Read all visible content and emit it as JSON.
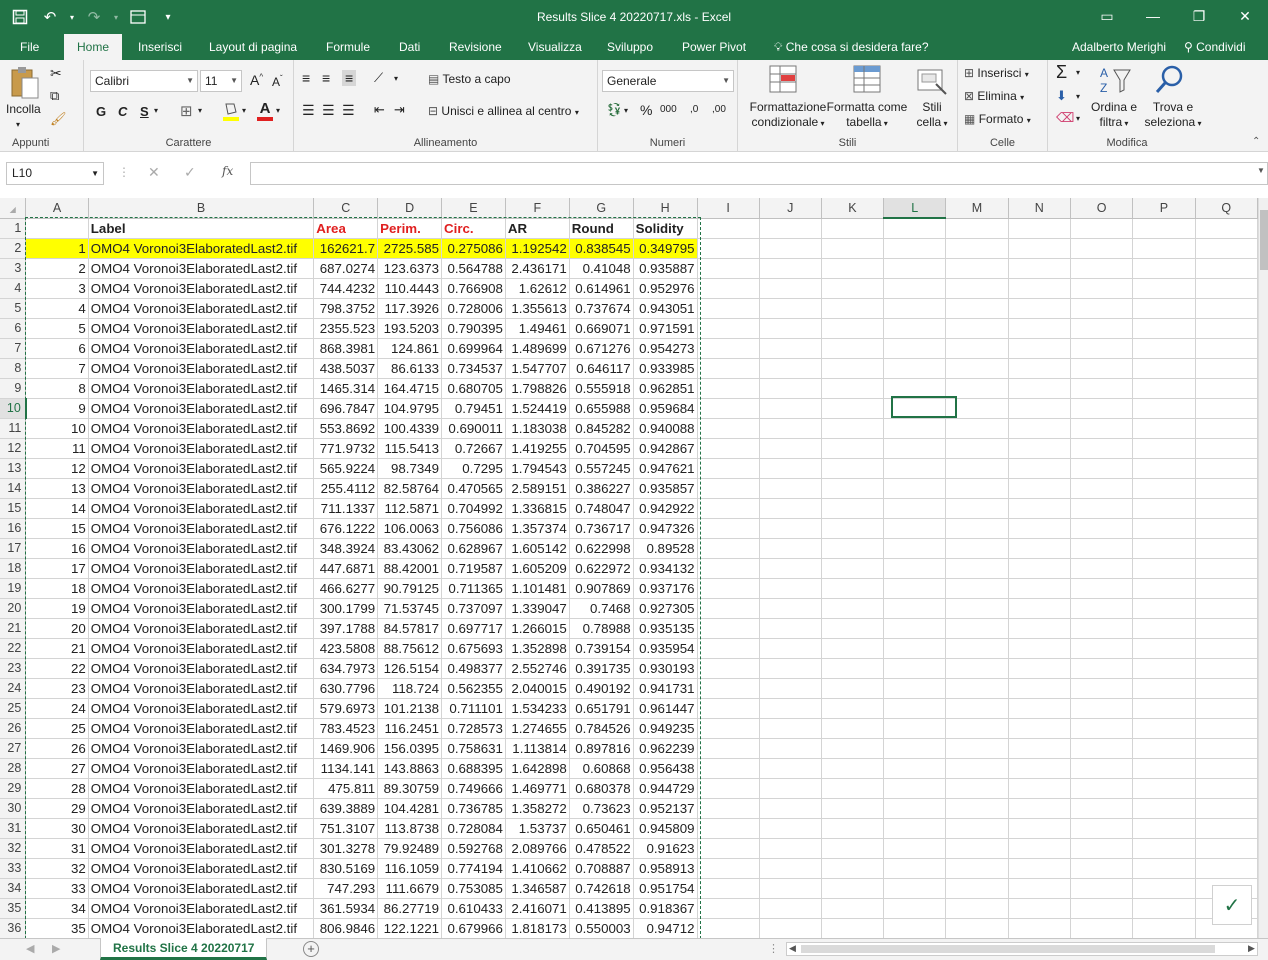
{
  "window": {
    "title": "Results Slice 4 20220717.xls - Excel",
    "qat": {
      "save_icon": "save-icon",
      "undo_icon": "undo-icon",
      "redo_icon": "redo-icon"
    }
  },
  "tabs": [
    "File",
    "Home",
    "Inserisci",
    "Layout di pagina",
    "Formule",
    "Dati",
    "Revisione",
    "Visualizza",
    "Sviluppo",
    "Power Pivot"
  ],
  "active_tab": "Home",
  "tell_me": "Che cosa si desidera fare?",
  "user": "Adalberto Merighi",
  "share": "Condividi",
  "ribbon": {
    "clipboard": {
      "paste": "Incolla",
      "label": "Appunti"
    },
    "font": {
      "name": "Calibri",
      "size": "11",
      "bold": "G",
      "italic": "C",
      "underline": "S",
      "label": "Carattere",
      "grow": "A",
      "shrink": "A",
      "color_letter": "A"
    },
    "alignment": {
      "wrap": "Testo a capo",
      "merge": "Unisci e allinea al centro",
      "label": "Allineamento"
    },
    "number": {
      "format": "Generale",
      "percent": "%",
      "thousands": "000",
      "dec_inc": ",0",
      "dec_dec": ",00",
      "label": "Numeri"
    },
    "styles": {
      "cond": "Formattazione",
      "cond2": "condizionale",
      "table": "Formatta come",
      "table2": "tabella",
      "cell": "Stili",
      "cell2": "cella",
      "label": "Stili"
    },
    "cells": {
      "insert": "Inserisci",
      "delete": "Elimina",
      "format": "Formato",
      "label": "Celle"
    },
    "editing": {
      "sort": "Ordina e",
      "sort2": "filtra",
      "find": "Trova e",
      "find2": "seleziona",
      "label": "Modifica"
    }
  },
  "formula_bar": {
    "name_box": "L10",
    "fx": "fx",
    "value": ""
  },
  "columns": [
    "A",
    "B",
    "C",
    "D",
    "E",
    "F",
    "G",
    "H",
    "I",
    "J",
    "K",
    "L",
    "M",
    "N",
    "O",
    "P",
    "Q"
  ],
  "headers": [
    "",
    "Label",
    "Area",
    "Perim.",
    "Circ.",
    "AR",
    "Round",
    "Solidity"
  ],
  "label_text": "OMO4 Voronoi3ElaboratedLast2.tif",
  "rows": [
    [
      "1",
      "162621.7",
      "2725.585",
      "0.275086",
      "1.192542",
      "0.838545",
      "0.349795"
    ],
    [
      "2",
      "687.0274",
      "123.6373",
      "0.564788",
      "2.436171",
      "0.41048",
      "0.935887"
    ],
    [
      "3",
      "744.4232",
      "110.4443",
      "0.766908",
      "1.62612",
      "0.614961",
      "0.952976"
    ],
    [
      "4",
      "798.3752",
      "117.3926",
      "0.728006",
      "1.355613",
      "0.737674",
      "0.943051"
    ],
    [
      "5",
      "2355.523",
      "193.5203",
      "0.790395",
      "1.49461",
      "0.669071",
      "0.971591"
    ],
    [
      "6",
      "868.3981",
      "124.861",
      "0.699964",
      "1.489699",
      "0.671276",
      "0.954273"
    ],
    [
      "7",
      "438.5037",
      "86.6133",
      "0.734537",
      "1.547707",
      "0.646117",
      "0.933985"
    ],
    [
      "8",
      "1465.314",
      "164.4715",
      "0.680705",
      "1.798826",
      "0.555918",
      "0.962851"
    ],
    [
      "9",
      "696.7847",
      "104.9795",
      "0.79451",
      "1.524419",
      "0.655988",
      "0.959684"
    ],
    [
      "10",
      "553.8692",
      "100.4339",
      "0.690011",
      "1.183038",
      "0.845282",
      "0.940088"
    ],
    [
      "11",
      "771.9732",
      "115.5413",
      "0.72667",
      "1.419255",
      "0.704595",
      "0.942867"
    ],
    [
      "12",
      "565.9224",
      "98.7349",
      "0.7295",
      "1.794543",
      "0.557245",
      "0.947621"
    ],
    [
      "13",
      "255.4112",
      "82.58764",
      "0.470565",
      "2.589151",
      "0.386227",
      "0.935857"
    ],
    [
      "14",
      "711.1337",
      "112.5871",
      "0.704992",
      "1.336815",
      "0.748047",
      "0.942922"
    ],
    [
      "15",
      "676.1222",
      "106.0063",
      "0.756086",
      "1.357374",
      "0.736717",
      "0.947326"
    ],
    [
      "16",
      "348.3924",
      "83.43062",
      "0.628967",
      "1.605142",
      "0.622998",
      "0.89528"
    ],
    [
      "17",
      "447.6871",
      "88.42001",
      "0.719587",
      "1.605209",
      "0.622972",
      "0.934132"
    ],
    [
      "18",
      "466.6277",
      "90.79125",
      "0.711365",
      "1.101481",
      "0.907869",
      "0.937176"
    ],
    [
      "19",
      "300.1799",
      "71.53745",
      "0.737097",
      "1.339047",
      "0.7468",
      "0.927305"
    ],
    [
      "20",
      "397.1788",
      "84.57817",
      "0.697717",
      "1.266015",
      "0.78988",
      "0.935135"
    ],
    [
      "21",
      "423.5808",
      "88.75612",
      "0.675693",
      "1.352898",
      "0.739154",
      "0.935954"
    ],
    [
      "22",
      "634.7973",
      "126.5154",
      "0.498377",
      "2.552746",
      "0.391735",
      "0.930193"
    ],
    [
      "23",
      "630.7796",
      "118.724",
      "0.562355",
      "2.040015",
      "0.490192",
      "0.941731"
    ],
    [
      "24",
      "579.6973",
      "101.2138",
      "0.711101",
      "1.534233",
      "0.651791",
      "0.961447"
    ],
    [
      "25",
      "783.4523",
      "116.2451",
      "0.728573",
      "1.274655",
      "0.784526",
      "0.949235"
    ],
    [
      "26",
      "1469.906",
      "156.0395",
      "0.758631",
      "1.113814",
      "0.897816",
      "0.962239"
    ],
    [
      "27",
      "1134.141",
      "143.8863",
      "0.688395",
      "1.642898",
      "0.60868",
      "0.956438"
    ],
    [
      "28",
      "475.811",
      "89.30759",
      "0.749666",
      "1.469771",
      "0.680378",
      "0.944729"
    ],
    [
      "29",
      "639.3889",
      "104.4281",
      "0.736785",
      "1.358272",
      "0.73623",
      "0.952137"
    ],
    [
      "30",
      "751.3107",
      "113.8738",
      "0.728084",
      "1.53737",
      "0.650461",
      "0.945809"
    ],
    [
      "31",
      "301.3278",
      "79.92489",
      "0.592768",
      "2.089766",
      "0.478522",
      "0.91623"
    ],
    [
      "32",
      "830.5169",
      "116.1059",
      "0.774194",
      "1.410662",
      "0.708887",
      "0.958913"
    ],
    [
      "33",
      "747.293",
      "111.6679",
      "0.753085",
      "1.346587",
      "0.742618",
      "0.951754"
    ],
    [
      "34",
      "361.5934",
      "86.27719",
      "0.610433",
      "2.416071",
      "0.413895",
      "0.918367"
    ],
    [
      "35",
      "806.9846",
      "122.1221",
      "0.679966",
      "1.818173",
      "0.550003",
      "0.94712"
    ]
  ],
  "sheet_tab": "Results Slice 4 20220717",
  "colors": {
    "excel_green": "#217346",
    "highlight": "#ffff00",
    "header_red": "#e02020"
  }
}
